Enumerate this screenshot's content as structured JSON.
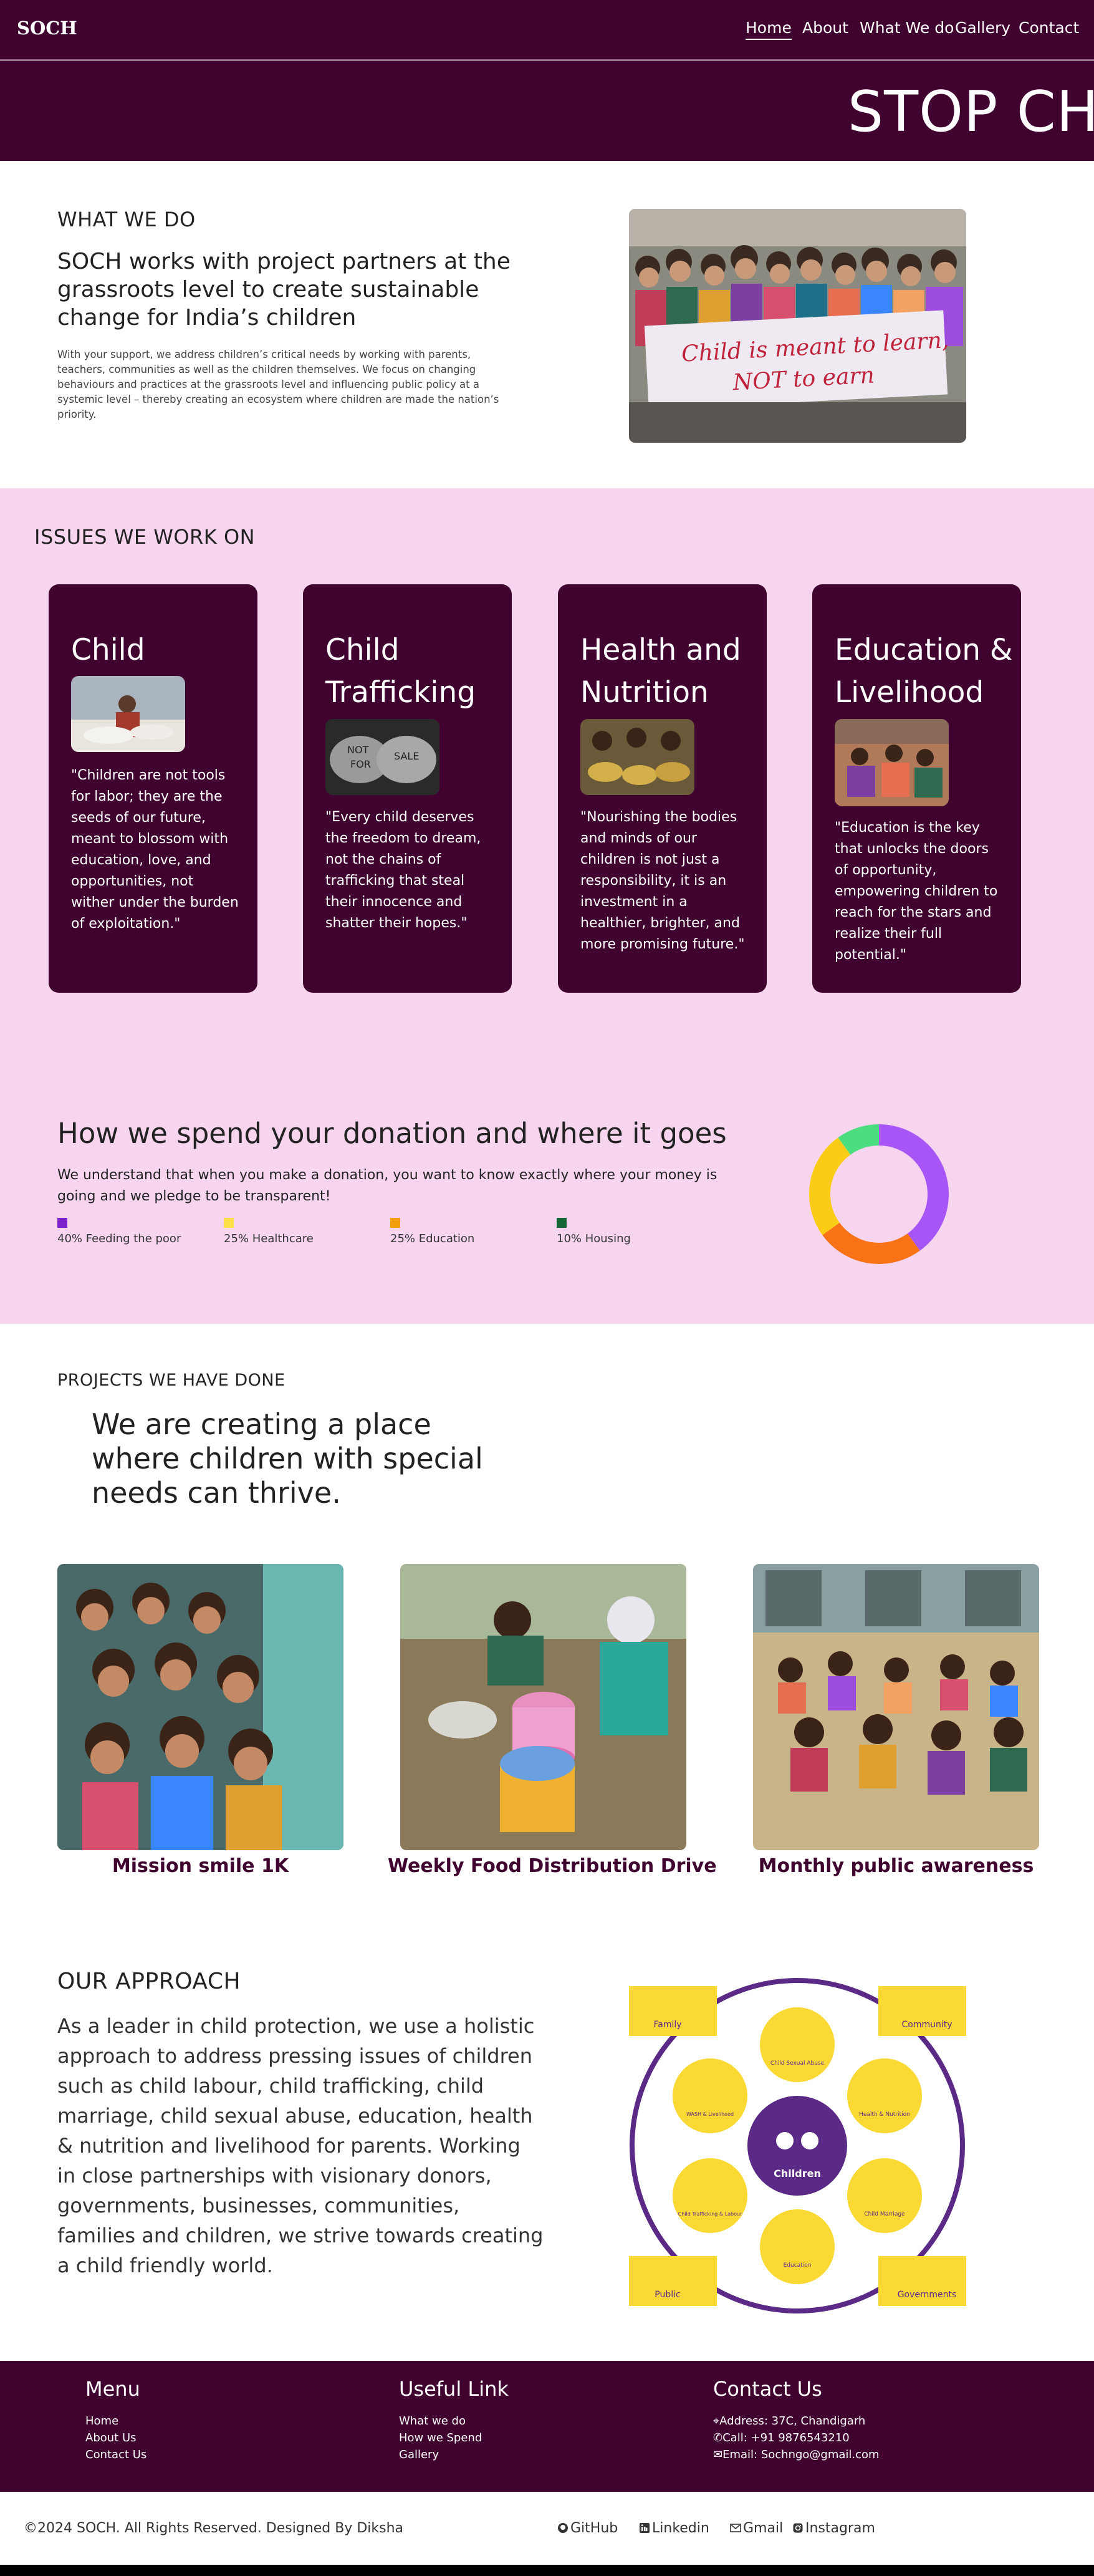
{
  "nav": {
    "logo": "SOCH",
    "links": [
      "Home",
      "About",
      "What We do",
      "Gallery",
      "Contact"
    ]
  },
  "hero": {
    "text": "STOP CHILD"
  },
  "what_we_do": {
    "kicker": "WHAT WE DO",
    "title": "SOCH works with project partners at the grassroots level to create sustainable change for India’s children",
    "body": "With your support, we address children’s critical needs by working with parents, teachers, communities as well as the children themselves. We focus on changing behaviours and practices at the grassroots level and influencing public policy at a systemic level – thereby creating an ecosystem where children are made the nation’s priority.",
    "banner_text_1": "Child is meant to learn,",
    "banner_text_2": "NOT to earn"
  },
  "issues": {
    "kicker": "ISSUES WE WORK ON",
    "cards": [
      {
        "title": "Child Labour",
        "quote": "\"Children are not tools for labor; they are the seeds of our future, meant to blossom with education, love, and opportunities, not wither under the burden of exploitation.\""
      },
      {
        "title": "Child Trafficking",
        "quote": "\"Every child deserves the freedom to dream, not the chains of trafficking that steal their innocence and shatter their hopes.\"",
        "hand_text_1": "NOT",
        "hand_text_2": "FOR",
        "hand_text_3": "SALE"
      },
      {
        "title": "Health and Nutrition",
        "quote": "\"Nourishing the bodies and minds of our children is not just a responsibility, it is an investment in a healthier, brighter, and more promising future.\""
      },
      {
        "title": "Education & Livelihood",
        "quote": "\"Education is the key that unlocks the doors of opportunity, empowering children to reach for the stars and realize their full potential.\""
      }
    ]
  },
  "donation": {
    "title": "How we spend your donation and where it goes",
    "subtitle": "We understand that when you make a donation, you want to know exactly where your money is going and we pledge to be transparent!",
    "legend": [
      {
        "label": "40% Feeding the poor",
        "color": "#7e22ce"
      },
      {
        "label": "25% Healthcare",
        "color": "#fde047"
      },
      {
        "label": "25% Education",
        "color": "#f59e0b"
      },
      {
        "label": "10% Housing",
        "color": "#166534"
      }
    ]
  },
  "chart_data": {
    "type": "pie",
    "categories": [
      "Feeding the poor",
      "Healthcare",
      "Education",
      "Housing"
    ],
    "values": [
      40,
      25,
      25,
      10
    ],
    "colors": [
      "#a855f7",
      "#facc15",
      "#f97316",
      "#4ade80"
    ]
  },
  "projects": {
    "kicker": "PROJECTS WE HAVE DONE",
    "title": "We are creating a place where children with special needs can thrive.",
    "items": [
      {
        "caption": "Mission smile 1K"
      },
      {
        "caption": "Weekly Food Distribution Drive"
      },
      {
        "caption": "Monthly public awareness"
      }
    ]
  },
  "approach": {
    "kicker": "OUR APPROACH",
    "body": "As a leader in child protection, we use a holistic approach to address pressing issues of children such as child labour, child trafficking, child marriage, child sexual abuse, education, health & nutrition and livelihood for parents. Working in close partnerships with visionary donors, governments, businesses, communities, families and children, we strive towards creating a child friendly world.",
    "diagram": {
      "center": "Children",
      "inner": [
        "Child Sexual Abuse",
        "Health & Nutrition",
        "Child Marriage",
        "Education",
        "Child Trafficking & Labour",
        "WASH & Livelihood"
      ],
      "corners": [
        "Family",
        "Community",
        "Public",
        "Governments"
      ]
    }
  },
  "footer": {
    "menu_title": "Menu",
    "menu": [
      "Home",
      "About Us",
      "Contact Us"
    ],
    "useful_title": "Useful Link",
    "useful": [
      "What we do",
      "How we Spend",
      "Gallery"
    ],
    "contact_title": "Contact Us",
    "contact": [
      "Address: 37C, Chandigarh",
      "Call: +91 9876543210",
      "Email: Sochngo@gmail.com"
    ],
    "copyright": "©2024 SOCH. All Rights Reserved. Designed By  Diksha",
    "social": [
      "GitHub",
      "Linkedin",
      "Gmail",
      "Instagram"
    ]
  }
}
